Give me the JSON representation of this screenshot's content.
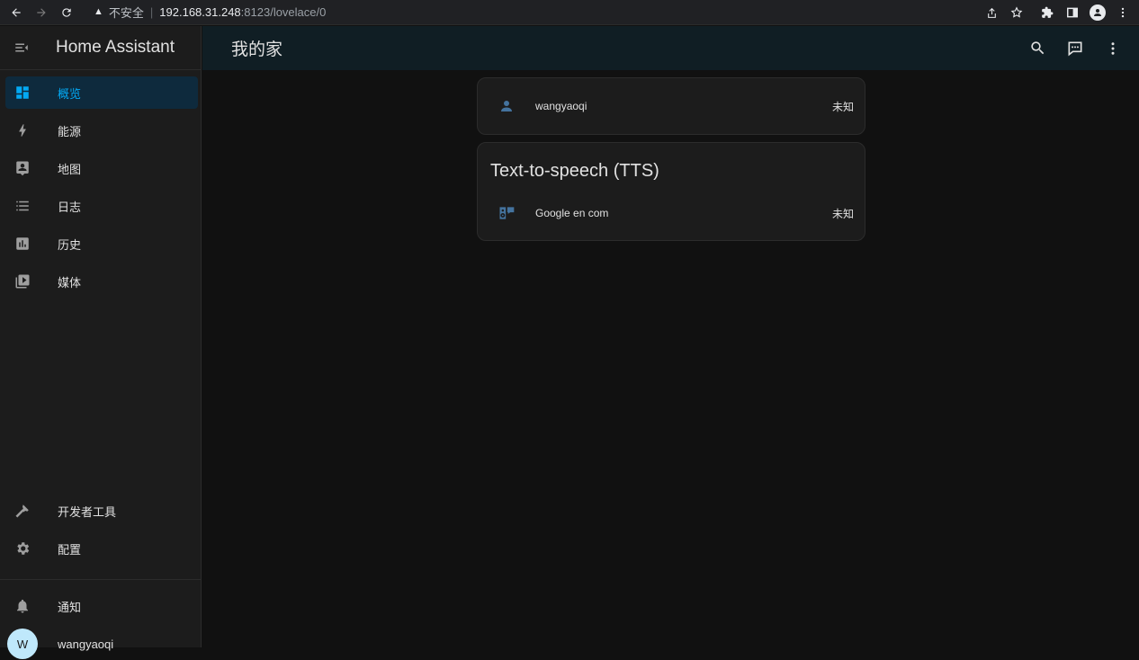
{
  "browser": {
    "insecure_label": "不安全",
    "url_host": "192.168.31.248",
    "url_path": ":8123/lovelace/0"
  },
  "sidebar": {
    "title": "Home Assistant",
    "items": [
      {
        "label": "概览",
        "icon": "dashboard-icon",
        "active": true
      },
      {
        "label": "能源",
        "icon": "lightning-icon"
      },
      {
        "label": "地图",
        "icon": "map-account-icon"
      },
      {
        "label": "日志",
        "icon": "list-icon"
      },
      {
        "label": "历史",
        "icon": "chart-box-icon"
      },
      {
        "label": "媒体",
        "icon": "media-play-icon"
      }
    ],
    "bottom_items": [
      {
        "label": "开发者工具",
        "icon": "hammer-icon"
      },
      {
        "label": "配置",
        "icon": "gear-icon"
      }
    ],
    "notifications_label": "通知",
    "user": {
      "initial": "W",
      "name": "wangyaoqi"
    }
  },
  "header": {
    "title": "我的家",
    "actions": [
      "search-icon",
      "assist-icon",
      "more-vert-icon"
    ]
  },
  "cards": [
    {
      "rows": [
        {
          "icon": "account-icon",
          "name": "wangyaoqi",
          "state": "未知"
        }
      ]
    },
    {
      "title": "Text-to-speech (TTS)",
      "rows": [
        {
          "icon": "speaker-message-icon",
          "name": "Google en com",
          "state": "未知"
        }
      ]
    }
  ],
  "colors": {
    "accent": "#03a9f4",
    "icon_blue": "#44739e",
    "sidebar_bg": "#1c1c1c",
    "header_bg": "#101e24",
    "page_bg": "#111111"
  }
}
